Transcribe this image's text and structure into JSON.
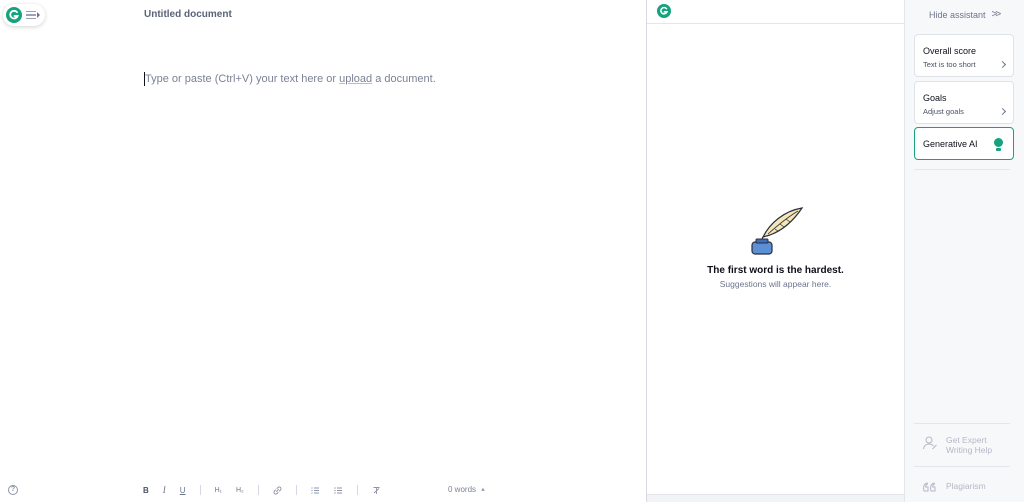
{
  "editor": {
    "doc_title": "Untitled document",
    "placeholder_before": "Type or paste (Ctrl+V) your text here or ",
    "placeholder_link": "upload",
    "placeholder_after": " a document.",
    "help_label": "?",
    "toolbar": {
      "bold": "B",
      "italic": "I",
      "underline": "U",
      "h1": "H₁",
      "h2": "H₂",
      "link": "🔗",
      "numbered_list": "≔",
      "bulleted_list": "☰",
      "clear_format": "T̸"
    },
    "word_count": "0 words",
    "word_count_caret": "▲"
  },
  "suggestions": {
    "empty_title": "The first word is the hardest.",
    "empty_subtitle": "Suggestions will appear here."
  },
  "assistant": {
    "hide_label": "Hide assistant",
    "hide_chevrons": ">>",
    "overall_score_title": "Overall score",
    "overall_score_sub": "Text is too short",
    "goals_title": "Goals",
    "goals_sub": "Adjust goals",
    "generative_ai_title": "Generative AI",
    "expert_label_line1": "Get Expert",
    "expert_label_line2": "Writing Help",
    "plagiarism_label": "Plagiarism"
  },
  "colors": {
    "brand_green": "#15a37d",
    "text_dark": "#0e101a",
    "text_muted": "#6d758d"
  },
  "icons": [
    "grammarly-logo-icon",
    "menu-icon",
    "help-icon",
    "quill-inkpot-icon",
    "chevron-right-icon",
    "bulb-icon",
    "expert-person-icon",
    "plagiarism-quote-icon"
  ]
}
